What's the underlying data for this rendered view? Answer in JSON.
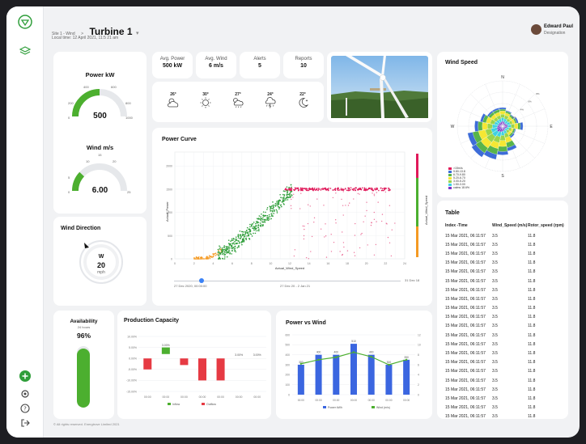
{
  "header": {
    "breadcrumb_site": "Site 1 - Wind",
    "breadcrumb_sep": ">",
    "title": "Turbine 1",
    "local_time": "Local time: 12 April 2021, 11:5 21 am",
    "user_name": "Edward Paul",
    "user_role": "Designation"
  },
  "power": {
    "title": "Power kW",
    "value": "500",
    "ticks": [
      "0",
      "200",
      "400",
      "600",
      "800",
      "1000"
    ],
    "fraction": 0.5
  },
  "wind": {
    "title": "Wind m/s",
    "value": "6.00",
    "ticks": [
      "0",
      "5",
      "10",
      "15",
      "20",
      "25"
    ],
    "fraction": 0.24
  },
  "direction": {
    "title": "Wind Direction",
    "dir": "W",
    "speed": "20",
    "unit": "mph"
  },
  "stats": [
    {
      "label": "Avg. Power",
      "value": "500 kW"
    },
    {
      "label": "Avg. Wind",
      "value": "6 m/s"
    },
    {
      "label": "Alerts",
      "value": "5"
    },
    {
      "label": "Reports",
      "value": "10"
    }
  ],
  "forecast": [
    {
      "temp": "26°",
      "icon": "partly-cloudy-icon"
    },
    {
      "temp": "30°",
      "icon": "sun-icon"
    },
    {
      "temp": "27°",
      "icon": "sun-cloud-rain-icon"
    },
    {
      "temp": "24°",
      "icon": "thunderstorm-icon"
    },
    {
      "temp": "22°",
      "icon": "moon-icon"
    }
  ],
  "power_curve": {
    "title": "Power Curve",
    "ylabel": "Actual_Power",
    "xlabel": "Actual_Wind_Speed",
    "right_label": "Actual_Wind_Speed",
    "range_start": "27 Dec 2020, 00:00:00",
    "range_mid": "27 Dec 20 - 2 Jan 21",
    "range_end": "31 Dec 18"
  },
  "wind_speed_title": "Wind Speed",
  "rose": {
    "dirs": [
      "N",
      "E",
      "S",
      "W"
    ],
    "rings": [
      "2%",
      "4%",
      "6%",
      "8%"
    ],
    "legend": [
      ">15m/s",
      "9.80-13.8",
      "6.70-9.80",
      "5.20-6.70",
      "3.00-5.20",
      "1.50-3.00",
      "calms 18.6%"
    ],
    "colors": [
      "#e0195a",
      "#3d6cd8",
      "#58b44b",
      "#f5e733",
      "#9bd54b",
      "#3fd1e2",
      "#7d34c9"
    ]
  },
  "table": {
    "title": "Table",
    "columns": [
      "Index -Time",
      "Wind_Speed (m/s)",
      "Rotor_speed (rpm)"
    ],
    "rows": [
      [
        "15 Mar 2021, 06:11:57",
        "3.5",
        "11.8"
      ],
      [
        "15 Mar 2021, 06:11:57",
        "3.5",
        "11.8"
      ],
      [
        "15 Mar 2021, 06:11:57",
        "3.5",
        "11.8"
      ],
      [
        "15 Mar 2021, 06:11:57",
        "3.5",
        "11.8"
      ],
      [
        "15 Mar 2021, 06:11:57",
        "3.5",
        "11.8"
      ],
      [
        "15 Mar 2021, 06:11:57",
        "3.5",
        "11.8"
      ],
      [
        "15 Mar 2021, 06:11:57",
        "3.5",
        "11.8"
      ],
      [
        "15 Mar 2021, 06:11:57",
        "3.5",
        "11.8"
      ],
      [
        "15 Mar 2021, 06:11:57",
        "3.5",
        "11.8"
      ],
      [
        "15 Mar 2021, 06:11:57",
        "3.5",
        "11.8"
      ],
      [
        "15 Mar 2021, 06:11:57",
        "3.5",
        "11.8"
      ],
      [
        "15 Mar 2021, 06:11:57",
        "3.5",
        "11.8"
      ],
      [
        "15 Mar 2021, 06:11:57",
        "3.5",
        "11.8"
      ],
      [
        "15 Mar 2021, 06:11:57",
        "3.5",
        "11.8"
      ],
      [
        "15 Mar 2021, 06:11:57",
        "3.5",
        "11.8"
      ],
      [
        "15 Mar 2021, 06:11:57",
        "3.5",
        "11.8"
      ],
      [
        "15 Mar 2021, 06:11:57",
        "3.5",
        "11.8"
      ],
      [
        "15 Mar 2021, 06:11:57",
        "3.5",
        "11.8"
      ],
      [
        "15 Mar 2021, 06:11:57",
        "3.5",
        "11.8"
      ],
      [
        "15 Mar 2021, 06:11:57",
        "3.5",
        "11.8"
      ],
      [
        "15 Mar 2021, 06:11:57",
        "3.5",
        "11.8"
      ]
    ]
  },
  "availability": {
    "title": "Availability",
    "sub": "24 hours",
    "value": "96%",
    "fraction": 0.96
  },
  "production": {
    "title": "Production Capacity",
    "legend": [
      "Inflow",
      "Outflow"
    ],
    "labels": [
      "3.00%",
      "3.00%",
      "3.00%"
    ],
    "yticks": [
      "10.00%",
      "5.00%",
      "0.00%",
      "-5.00%",
      "-10.00%",
      "-15.00%"
    ]
  },
  "pvw": {
    "title": "Power vs Wind",
    "legend": [
      "Power kWh",
      "Wind (m/s)"
    ]
  },
  "footer": "© All rights reserved. Energtrove Limited 2021",
  "colors": {
    "accent": "#4caf2f",
    "red": "#e63a43",
    "blue": "#3b66e0",
    "orange": "#f59a23"
  },
  "chart_data": [
    {
      "type": "bar",
      "name": "Power vs Wind",
      "categories": [
        "00:00",
        "00:00",
        "00:00",
        "00:00",
        "00:00",
        "00:00",
        "00:00"
      ],
      "series": [
        {
          "name": "Power kWh",
          "values": [
            300,
            400,
            400,
            510,
            400,
            300,
            350
          ]
        },
        {
          "name": "Wind (m/s)",
          "values": [
            6.2,
            7.0,
            7.5,
            8.5,
            7.6,
            6.0,
            7.0
          ]
        }
      ],
      "ylim": [
        0,
        600
      ]
    },
    {
      "type": "bar",
      "name": "Production Capacity",
      "categories": [
        "00:00",
        "00:00",
        "00:00",
        "00:00",
        "00:00",
        "00:00",
        "00:00"
      ],
      "series": [
        {
          "name": "Inflow",
          "values": [
            0,
            3,
            0,
            0,
            0,
            0,
            0
          ]
        },
        {
          "name": "Outflow",
          "values": [
            -5,
            0,
            -3,
            -10,
            -10,
            0,
            0
          ]
        }
      ],
      "ylim": [
        -15,
        10
      ]
    }
  ]
}
